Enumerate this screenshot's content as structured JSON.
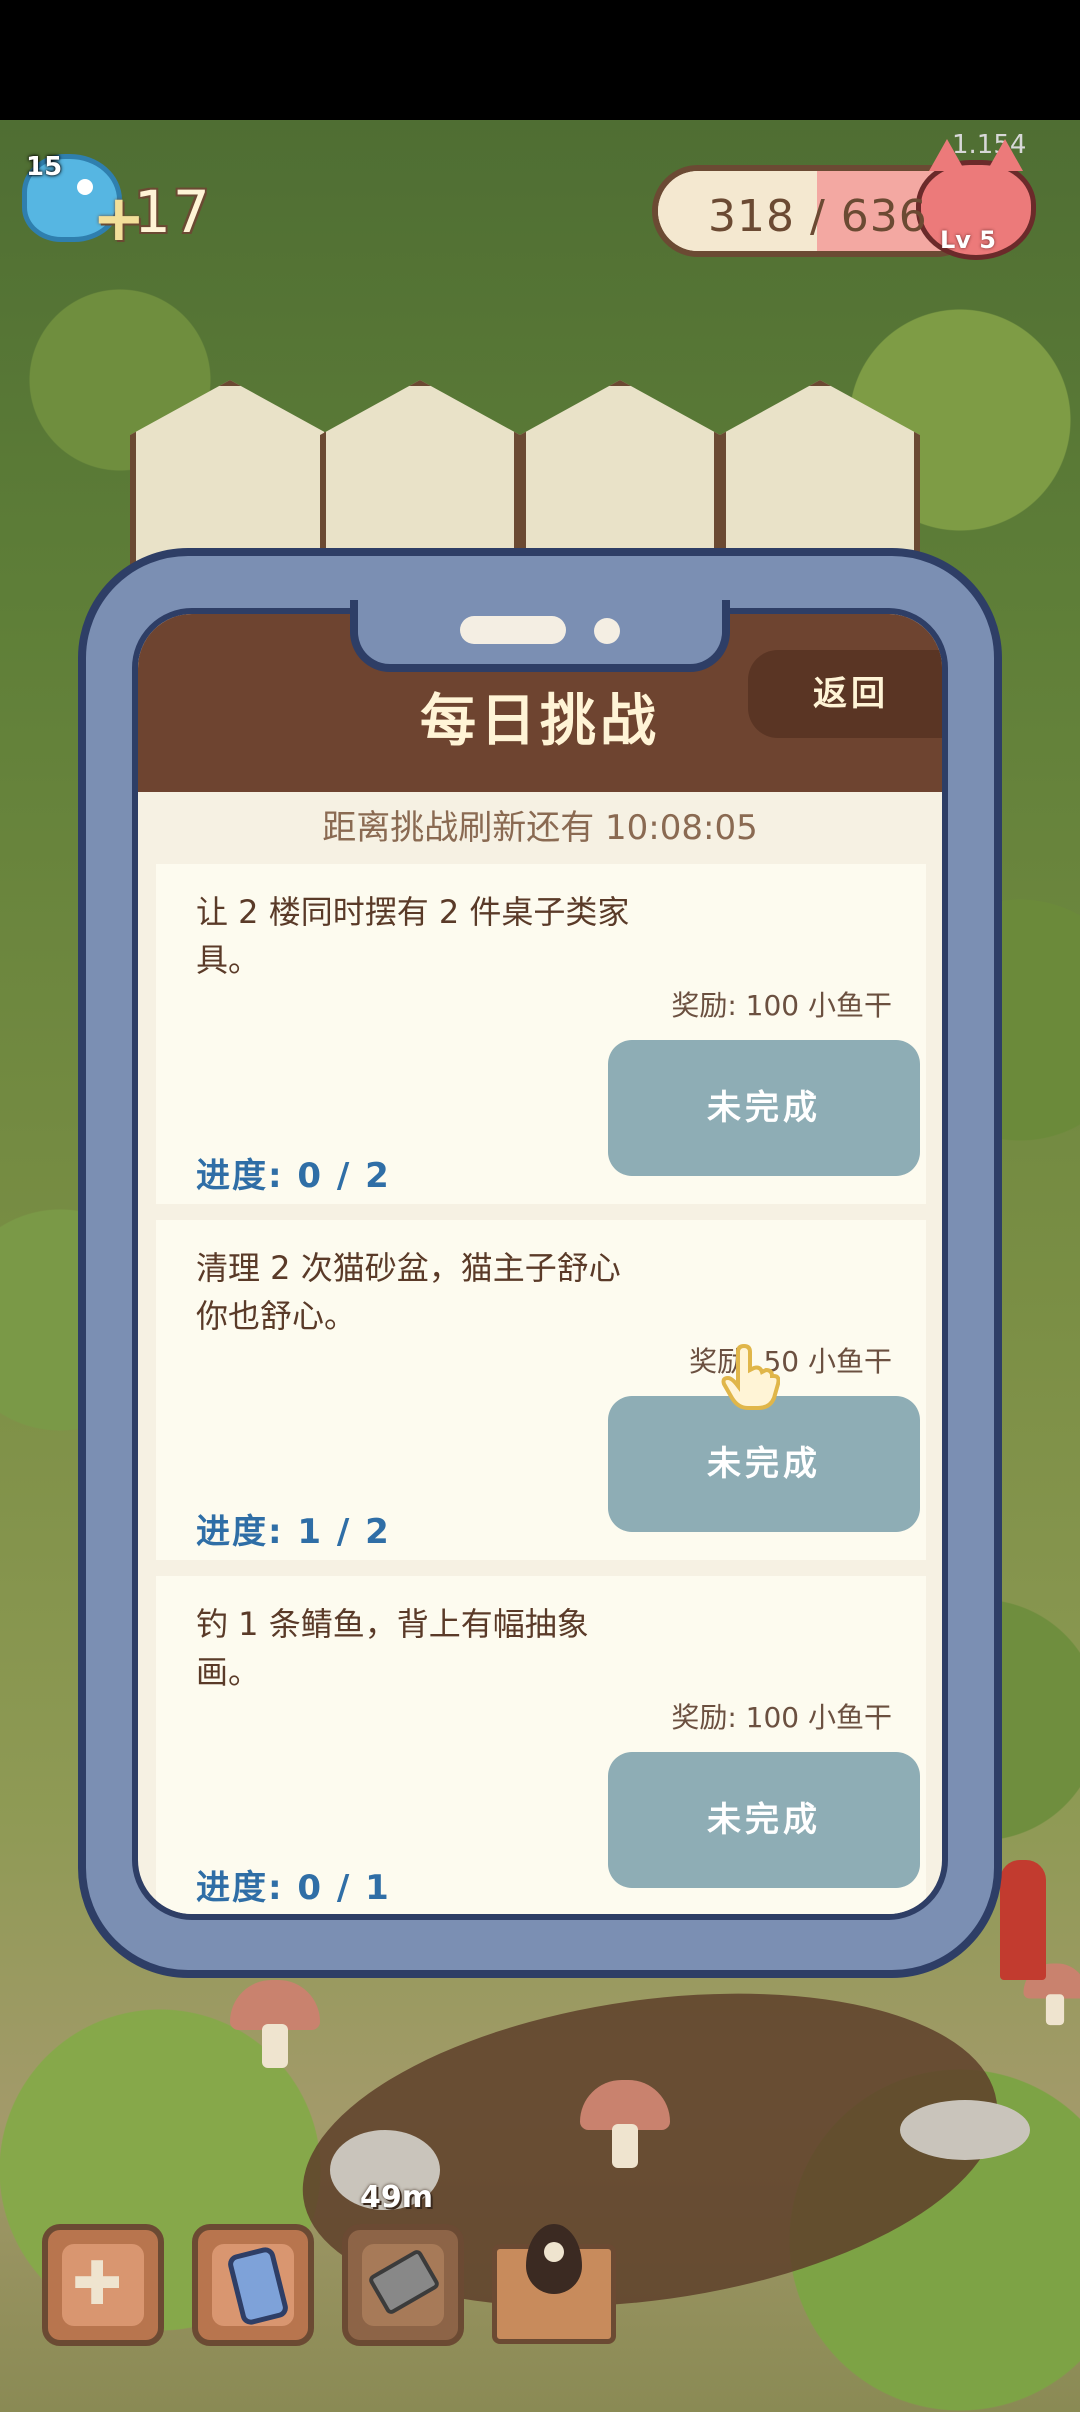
{
  "hud": {
    "level": "15",
    "plus": "+",
    "fish_count": "17",
    "version": "1.154",
    "exp_text": "318 / 636",
    "exp_progress": 0.5,
    "cat_level": "Lv 5"
  },
  "dialog": {
    "title": "每日挑战",
    "back_label": "返回",
    "refresh_text": "距离挑战刷新还有 10:08:05",
    "challenges": [
      {
        "desc": "让 2 楼同时摆有 2 件桌子类家具。",
        "reward": "奖励: 100 小鱼干",
        "status": "未完成",
        "progress": "进度: 0 / 2"
      },
      {
        "desc": "清理 2 次猫砂盆，猫主子舒心你也舒心。",
        "reward": "奖励: 50 小鱼干",
        "status": "未完成",
        "progress": "进度: 1 / 2"
      },
      {
        "desc": "钓 1 条鲭鱼，背上有幅抽象画。",
        "reward": "奖励: 100 小鱼干",
        "status": "未完成",
        "progress": "进度: 0 / 1"
      }
    ]
  },
  "toolbar": {
    "timer": "49m",
    "icons": [
      "move-cross-icon",
      "phone-icon",
      "litter-scoop-icon",
      "map-pin-icon"
    ]
  },
  "colors": {
    "header_brown": "#6e4430",
    "button_teal": "#8eadb5",
    "progress_blue": "#2f6ea6",
    "phone_frame": "#7b8fb3"
  }
}
